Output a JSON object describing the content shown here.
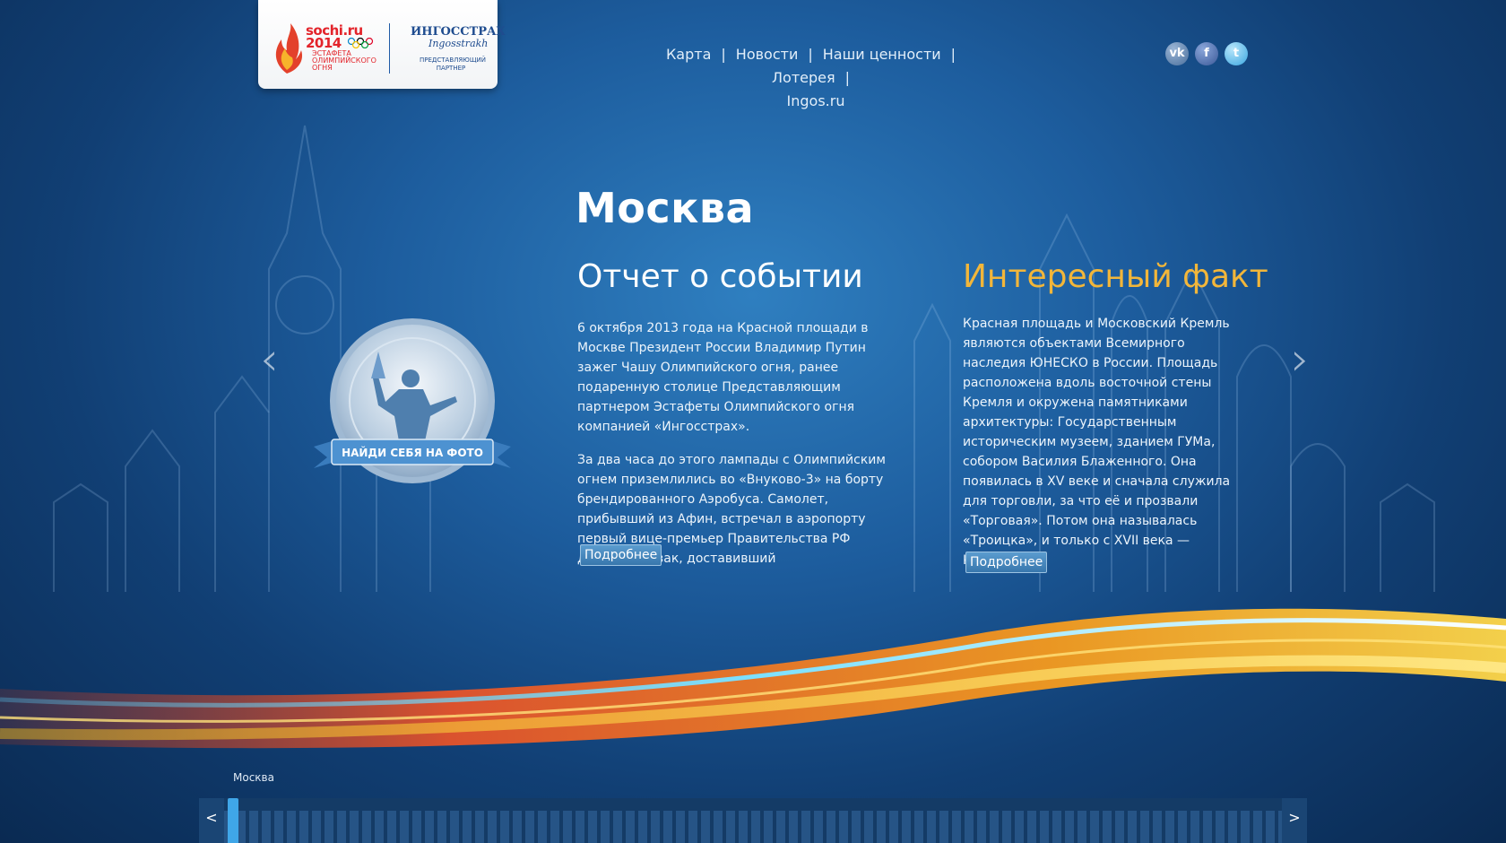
{
  "header": {
    "sochi_logo": {
      "title_line1": "sochi.ru",
      "title_line2": "2014",
      "subtitle": "ЭСТАФЕТА ОЛИМПИЙСКОГО ОГНЯ"
    },
    "partner_logo": {
      "title": "ИНГОССТРАХ",
      "script": "Ingosstrakh",
      "subtitle": "ПРЕДСТАВЛЯЮЩИЙ ПАРТНЕР"
    }
  },
  "nav": {
    "items": [
      "Карта",
      "Новости",
      "Наши ценности",
      "Лотерея",
      "Ingos.ru"
    ],
    "separator": "|"
  },
  "social": {
    "vk": "vk",
    "facebook": "f",
    "twitter": "t"
  },
  "city": "Москва",
  "report": {
    "title": "Отчет о событии",
    "paragraphs": [
      "6 октября 2013 года на Красной площади в Москве Президент России Владимир Путин зажег Чашу Олимпийского огня, ранее подаренную столице Представляющим партнером Эстафеты Олимпийского огня компанией «Ингосстрах».",
      "За два часа до этого лампады с Олимпийским огнем приземлились во «Внуково-3» на борту брендированного Аэробуса. Самолет, прибывший из Афин, встречал в аэропорту первый вице-премьер Правительства РФ Дмитрий Козак, доставивший"
    ],
    "more_label": "Подробнее"
  },
  "fact": {
    "title": "Интересный факт",
    "text": "Красная площадь и Московский Кремль являются объектами Всемирного наследия ЮНЕСКО в России. Площадь расположена вдоль восточной стены Кремля и окружена памятниками архитектуры: Государственным историческим музеем, зданием ГУМа, собором Василия Блаженного. Она появилась в XV веке и сначала служила для торговли, за что её и прозвали «Торговая». Потом она называлась «Троицка», и только с XVII века — Красная.",
    "more_label": "Подробнее"
  },
  "medal": {
    "label": "НАЙДИ СЕБЯ НА ФОТО"
  },
  "slider": {
    "prev": "‹",
    "next": "›"
  },
  "timeline": {
    "current_city": "Москва",
    "prev": "<",
    "next": ">"
  },
  "colors": {
    "accent_fact": "#f2b63a",
    "background": "#1d5d9e"
  }
}
